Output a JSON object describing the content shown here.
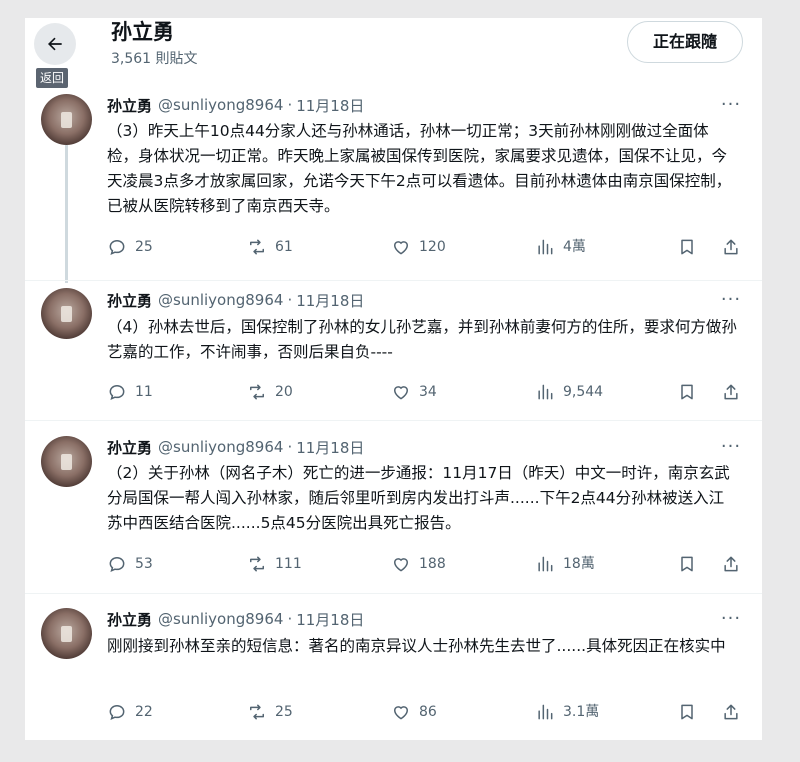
{
  "header": {
    "back_tooltip": "返回",
    "profile_name": "孙立勇",
    "post_count": "3,561 則貼文",
    "follow_label": "正在跟隨"
  },
  "tweets": [
    {
      "name": "孙立勇",
      "handle": "@sunliyong8964",
      "dot": "·",
      "date": "11月18日",
      "more": "···",
      "text": "（3）昨天上午10点44分家人还与孙林通话，孙林一切正常；3天前孙林刚刚做过全面体检，身体状况一切正常。昨天晚上家属被国保传到医院，家属要求见遗体，国保不让见，今天凌晨3点多才放家属回家，允诺今天下午2点可以看遗体。目前孙林遗体由南京国保控制，已被从医院转移到了南京西天寺。",
      "replies": "25",
      "retweets": "61",
      "likes": "120",
      "views": "4萬"
    },
    {
      "name": "孙立勇",
      "handle": "@sunliyong8964",
      "dot": "·",
      "date": "11月18日",
      "more": "···",
      "text": "（4）孙林去世后，国保控制了孙林的女儿孙艺嘉，并到孙林前妻何方的住所，要求何方做孙艺嘉的工作，不许闹事，否则后果自负----",
      "replies": "11",
      "retweets": "20",
      "likes": "34",
      "views": "9,544"
    },
    {
      "name": "孙立勇",
      "handle": "@sunliyong8964",
      "dot": "·",
      "date": "11月18日",
      "more": "···",
      "text": "（2）关于孙林（网名子木）死亡的进一步通报：11月17日（昨天）中文一时许，南京玄武分局国保一帮人闯入孙林家，随后邻里听到房内发出打斗声......下午2点44分孙林被送入江苏中西医结合医院......5点45分医院出具死亡报告。",
      "replies": "53",
      "retweets": "111",
      "likes": "188",
      "views": "18萬"
    },
    {
      "name": "孙立勇",
      "handle": "@sunliyong8964",
      "dot": "·",
      "date": "11月18日",
      "more": "···",
      "text": "刚刚接到孙林至亲的短信息：著名的南京异议人士孙林先生去世了......具体死因正在核实中",
      "replies": "22",
      "retweets": "25",
      "likes": "86",
      "views": "3.1萬"
    }
  ],
  "colors": {
    "text_primary": "#0f1419",
    "text_secondary": "#536471",
    "border": "#cfd9de",
    "thread_line": "#cfd9de",
    "page_background": "#e9e9ea"
  },
  "icons": {
    "back": "arrow-left-icon",
    "more": "more-horizontal-icon",
    "reply": "reply-bubble-icon",
    "retweet": "retweet-icon",
    "like": "heart-icon",
    "views": "bar-chart-icon",
    "bookmark": "bookmark-icon",
    "share": "share-icon"
  }
}
